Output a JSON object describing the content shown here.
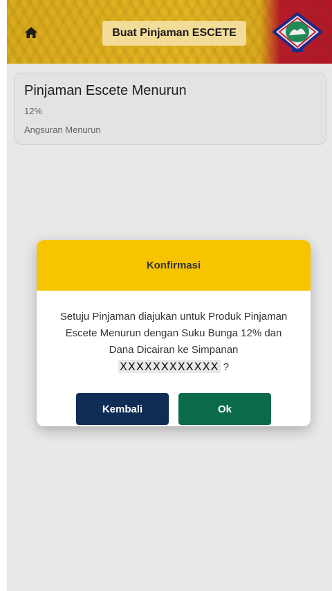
{
  "header": {
    "title": "Buat Pinjaman ESCETE",
    "home_icon": "home-icon",
    "logo_icon": "logo-emblem",
    "colors": {
      "gold": "#e2b423",
      "red": "#b0162a",
      "title_bg": "#f2dc98"
    }
  },
  "product": {
    "name": "Pinjaman Escete Menurun",
    "rate": "12%",
    "type": "Angsuran Menurun"
  },
  "dialog": {
    "title": "Konfirmasi",
    "message": "Setuju Pinjaman diajukan untuk Produk Pinjaman Escete Menurun dengan Suku Bunga 12% dan Dana Dicairan ke Simpanan",
    "account": "XXXXXXXXXXXX",
    "suffix": " ?",
    "back_label": "Kembali",
    "ok_label": "Ok",
    "colors": {
      "header": "#f7c400",
      "back": "#0f2c55",
      "ok": "#0b6a4c"
    }
  }
}
